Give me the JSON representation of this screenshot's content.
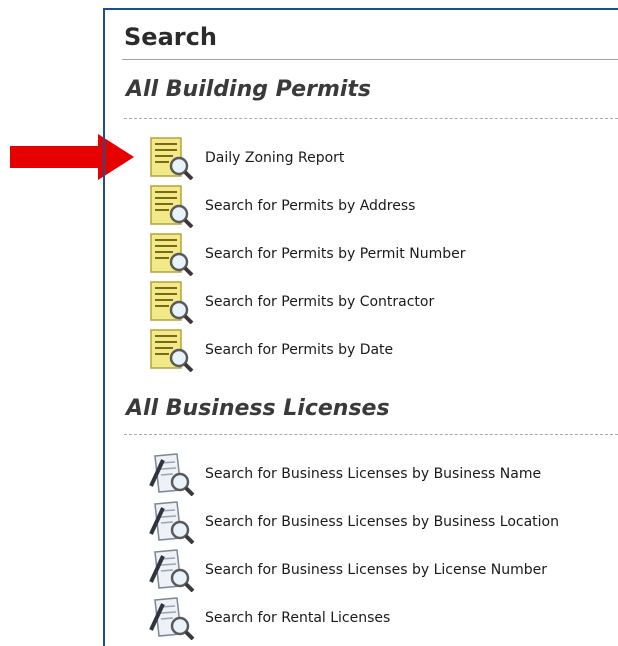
{
  "panel": {
    "title": "Search"
  },
  "sections": {
    "permits": {
      "title": "All Building Permits",
      "items": [
        {
          "label": "Daily Zoning Report",
          "icon": "permit-search-icon"
        },
        {
          "label": "Search for Permits by Address",
          "icon": "permit-search-icon"
        },
        {
          "label": "Search for Permits by Permit Number",
          "icon": "permit-search-icon"
        },
        {
          "label": "Search for Permits by Contractor",
          "icon": "permit-search-icon"
        },
        {
          "label": "Search for Permits by Date",
          "icon": "permit-search-icon"
        }
      ]
    },
    "licenses": {
      "title": "All Business Licenses",
      "items": [
        {
          "label": "Search for Business Licenses by Business Name",
          "icon": "license-search-icon"
        },
        {
          "label": "Search for Business Licenses by Business Location",
          "icon": "license-search-icon"
        },
        {
          "label": "Search for Business Licenses by License Number",
          "icon": "license-search-icon"
        },
        {
          "label": "Search for Rental Licenses",
          "icon": "license-search-icon"
        }
      ]
    }
  },
  "colors": {
    "panel_border": "#1f4f8a",
    "arrow": "#e60000",
    "permit_icon_fill": "#f2e98a",
    "link_text": "#1a1a1a"
  }
}
